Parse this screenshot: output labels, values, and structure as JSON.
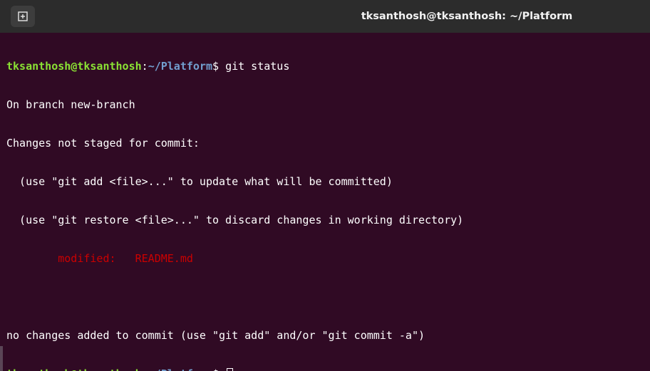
{
  "window": {
    "title": "tksanthosh@tksanthosh: ~/Platform"
  },
  "titlebar": {
    "new_tab_icon": "new-tab-icon"
  },
  "prompt": {
    "user_host": "tksanthosh@tksanthosh",
    "colon": ":",
    "path": "~/Platform",
    "dollar": "$ "
  },
  "terminal": {
    "command": "git status",
    "line1": "On branch new-branch",
    "line2": "Changes not staged for commit:",
    "line3": "  (use \"git add <file>...\" to update what will be committed)",
    "line4": "  (use \"git restore <file>...\" to discard changes in working directory)",
    "modified_label": "        modified:   ",
    "modified_file": "README.md",
    "line7": "no changes added to commit (use \"git add\" and/or \"git commit -a\")"
  },
  "colors": {
    "background": "#300a24",
    "prompt_user": "#8ae234",
    "prompt_path": "#729fcf",
    "modified": "#cc0000"
  }
}
